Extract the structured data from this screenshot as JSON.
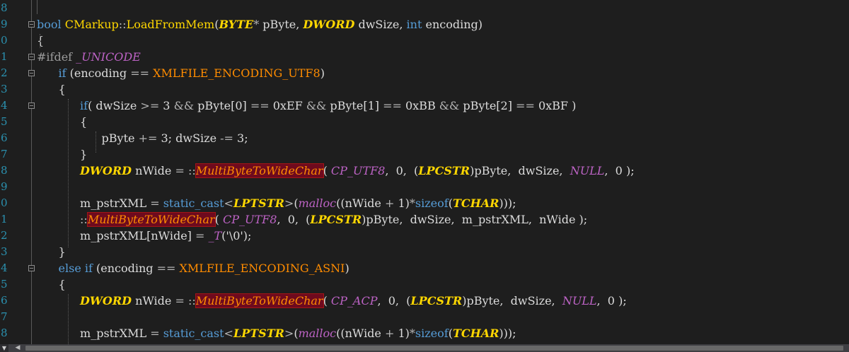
{
  "editor": {
    "lines": [
      {
        "n": "8",
        "t": []
      },
      {
        "n": "9",
        "t": [
          [
            "kw",
            "bool"
          ],
          [
            "",
            " "
          ],
          [
            "fn",
            "CMarkup"
          ],
          [
            "op",
            "::"
          ],
          [
            "fn",
            "LoadFromMem"
          ],
          [
            "",
            "("
          ],
          [
            "ty",
            "BYTE"
          ],
          [
            "op",
            "*"
          ],
          [
            "",
            " pByte, "
          ],
          [
            "ty",
            "DWORD"
          ],
          [
            "",
            " dwSize, "
          ],
          [
            "kw",
            "int"
          ],
          [
            "",
            " encoding)"
          ]
        ]
      },
      {
        "n": "0",
        "t": [
          [
            "",
            "{"
          ]
        ]
      },
      {
        "n": "1",
        "t": [
          [
            "pp",
            "#ifdef "
          ],
          [
            "mac",
            "_UNICODE"
          ]
        ]
      },
      {
        "n": "2",
        "t": [
          [
            "",
            "      "
          ],
          [
            "kw",
            "if"
          ],
          [
            "",
            " (encoding "
          ],
          [
            "op",
            "=="
          ],
          [
            "",
            ""
          ],
          [
            "en",
            " XMLFILE_ENCODING_UTF8"
          ],
          [
            "",
            ")"
          ]
        ]
      },
      {
        "n": "3",
        "t": [
          [
            "",
            "      {"
          ]
        ]
      },
      {
        "n": "4",
        "t": [
          [
            "",
            "            "
          ],
          [
            "kw",
            "if"
          ],
          [
            "",
            "( dwSize "
          ],
          [
            "op",
            ">="
          ],
          [
            "",
            " 3 "
          ],
          [
            "op",
            "&&"
          ],
          [
            "",
            " pByte[0] "
          ],
          [
            "op",
            "=="
          ],
          [
            "",
            " 0xEF "
          ],
          [
            "op",
            "&&"
          ],
          [
            "",
            " pByte[1] "
          ],
          [
            "op",
            "=="
          ],
          [
            "",
            " 0xBB "
          ],
          [
            "op",
            "&&"
          ],
          [
            "",
            " pByte[2] "
          ],
          [
            "op",
            "=="
          ],
          [
            "",
            " 0xBF )"
          ]
        ]
      },
      {
        "n": "5",
        "t": [
          [
            "",
            "            {"
          ]
        ]
      },
      {
        "n": "6",
        "t": [
          [
            "",
            "                  pByte "
          ],
          [
            "op",
            "+="
          ],
          [
            "",
            " 3; dwSize "
          ],
          [
            "op",
            "-="
          ],
          [
            "",
            " 3;"
          ]
        ]
      },
      {
        "n": "7",
        "t": [
          [
            "",
            "            }"
          ]
        ]
      },
      {
        "n": "8",
        "t": [
          [
            "",
            "            "
          ],
          [
            "ty",
            "DWORD"
          ],
          [
            "",
            " nWide "
          ],
          [
            "op",
            "="
          ],
          [
            "",
            " "
          ],
          [
            "op",
            "::"
          ],
          [
            "hl",
            "MultiByteToWideChar"
          ],
          [
            "",
            "( "
          ],
          [
            "ce",
            "CP_UTF8"
          ],
          [
            "",
            ",  0,  ("
          ],
          [
            "ty",
            "LPCSTR"
          ],
          [
            "",
            ")pByte,  dwSize,  "
          ],
          [
            "ce",
            "NULL"
          ],
          [
            "",
            ",  0 );"
          ]
        ]
      },
      {
        "n": "9",
        "t": []
      },
      {
        "n": "0",
        "t": [
          [
            "",
            "            m_pstrXML "
          ],
          [
            "op",
            "="
          ],
          [
            "",
            " "
          ],
          [
            "kw",
            "static_cast"
          ],
          [
            "op",
            "<"
          ],
          [
            "ty",
            "LPTSTR"
          ],
          [
            "op",
            ">"
          ],
          [
            "",
            "("
          ],
          [
            "ce",
            "malloc"
          ],
          [
            "",
            "((nWide "
          ],
          [
            "op",
            "+"
          ],
          [
            "",
            " 1)"
          ],
          [
            "op",
            "*"
          ],
          [
            "kw",
            "sizeof"
          ],
          [
            "",
            "("
          ],
          [
            "ty",
            "TCHAR"
          ],
          [
            "",
            "))); "
          ]
        ]
      },
      {
        "n": "1",
        "t": [
          [
            "",
            "            "
          ],
          [
            "op",
            "::"
          ],
          [
            "hl",
            "MultiByteToWideChar"
          ],
          [
            "",
            "( "
          ],
          [
            "ce",
            "CP_UTF8"
          ],
          [
            "",
            ",  0,  ("
          ],
          [
            "ty",
            "LPCSTR"
          ],
          [
            "",
            ")pByte,  dwSize,  m_pstrXML,  nWide );"
          ]
        ]
      },
      {
        "n": "2",
        "t": [
          [
            "",
            "            m_pstrXML[nWide] "
          ],
          [
            "op",
            "="
          ],
          [
            "",
            " "
          ],
          [
            "ce",
            "_T"
          ],
          [
            "",
            "('\\0');"
          ]
        ]
      },
      {
        "n": "3",
        "t": [
          [
            "",
            "      }"
          ]
        ]
      },
      {
        "n": "4",
        "t": [
          [
            "",
            "      "
          ],
          [
            "kw",
            "else if"
          ],
          [
            "",
            " (encoding "
          ],
          [
            "op",
            "=="
          ],
          [
            "",
            " "
          ],
          [
            "en",
            "XMLFILE_ENCODING_ASNI"
          ],
          [
            "",
            ")"
          ]
        ]
      },
      {
        "n": "5",
        "t": [
          [
            "",
            "      {"
          ]
        ]
      },
      {
        "n": "6",
        "t": [
          [
            "",
            "            "
          ],
          [
            "ty",
            "DWORD"
          ],
          [
            "",
            " nWide "
          ],
          [
            "op",
            "="
          ],
          [
            "",
            " "
          ],
          [
            "op",
            "::"
          ],
          [
            "hl",
            "MultiByteToWideChar"
          ],
          [
            "",
            "( "
          ],
          [
            "ce",
            "CP_ACP"
          ],
          [
            "",
            ",  0,  ("
          ],
          [
            "ty",
            "LPCSTR"
          ],
          [
            "",
            ")pByte,  dwSize,  "
          ],
          [
            "ce",
            "NULL"
          ],
          [
            "",
            ",  0 );"
          ]
        ]
      },
      {
        "n": "7",
        "t": []
      },
      {
        "n": "8",
        "t": [
          [
            "",
            "            m_pstrXML "
          ],
          [
            "op",
            "="
          ],
          [
            "",
            " "
          ],
          [
            "kw",
            "static_cast"
          ],
          [
            "op",
            "<"
          ],
          [
            "ty",
            "LPTSTR"
          ],
          [
            "op",
            ">"
          ],
          [
            "",
            "("
          ],
          [
            "ce",
            "malloc"
          ],
          [
            "",
            "((nWide "
          ],
          [
            "op",
            "+"
          ],
          [
            "",
            " 1)"
          ],
          [
            "op",
            "*"
          ],
          [
            "kw",
            "sizeof"
          ],
          [
            "",
            "("
          ],
          [
            "ty",
            "TCHAR"
          ],
          [
            "",
            ")));"
          ]
        ]
      }
    ]
  },
  "scrollbar": {
    "left_icon": "dropdown-arrow-icon",
    "left_glyph": "▼",
    "arrow_icon": "scroll-left-arrow-icon",
    "arrow_glyph": "◀"
  },
  "colors": {
    "background": "#1e1e1e",
    "line_number": "#2b91af",
    "keyword": "#569cd6",
    "function": "#ffd700",
    "enum": "#ff8c00",
    "macro": "#bd63c5",
    "error_highlight": "#6e0a1e"
  }
}
